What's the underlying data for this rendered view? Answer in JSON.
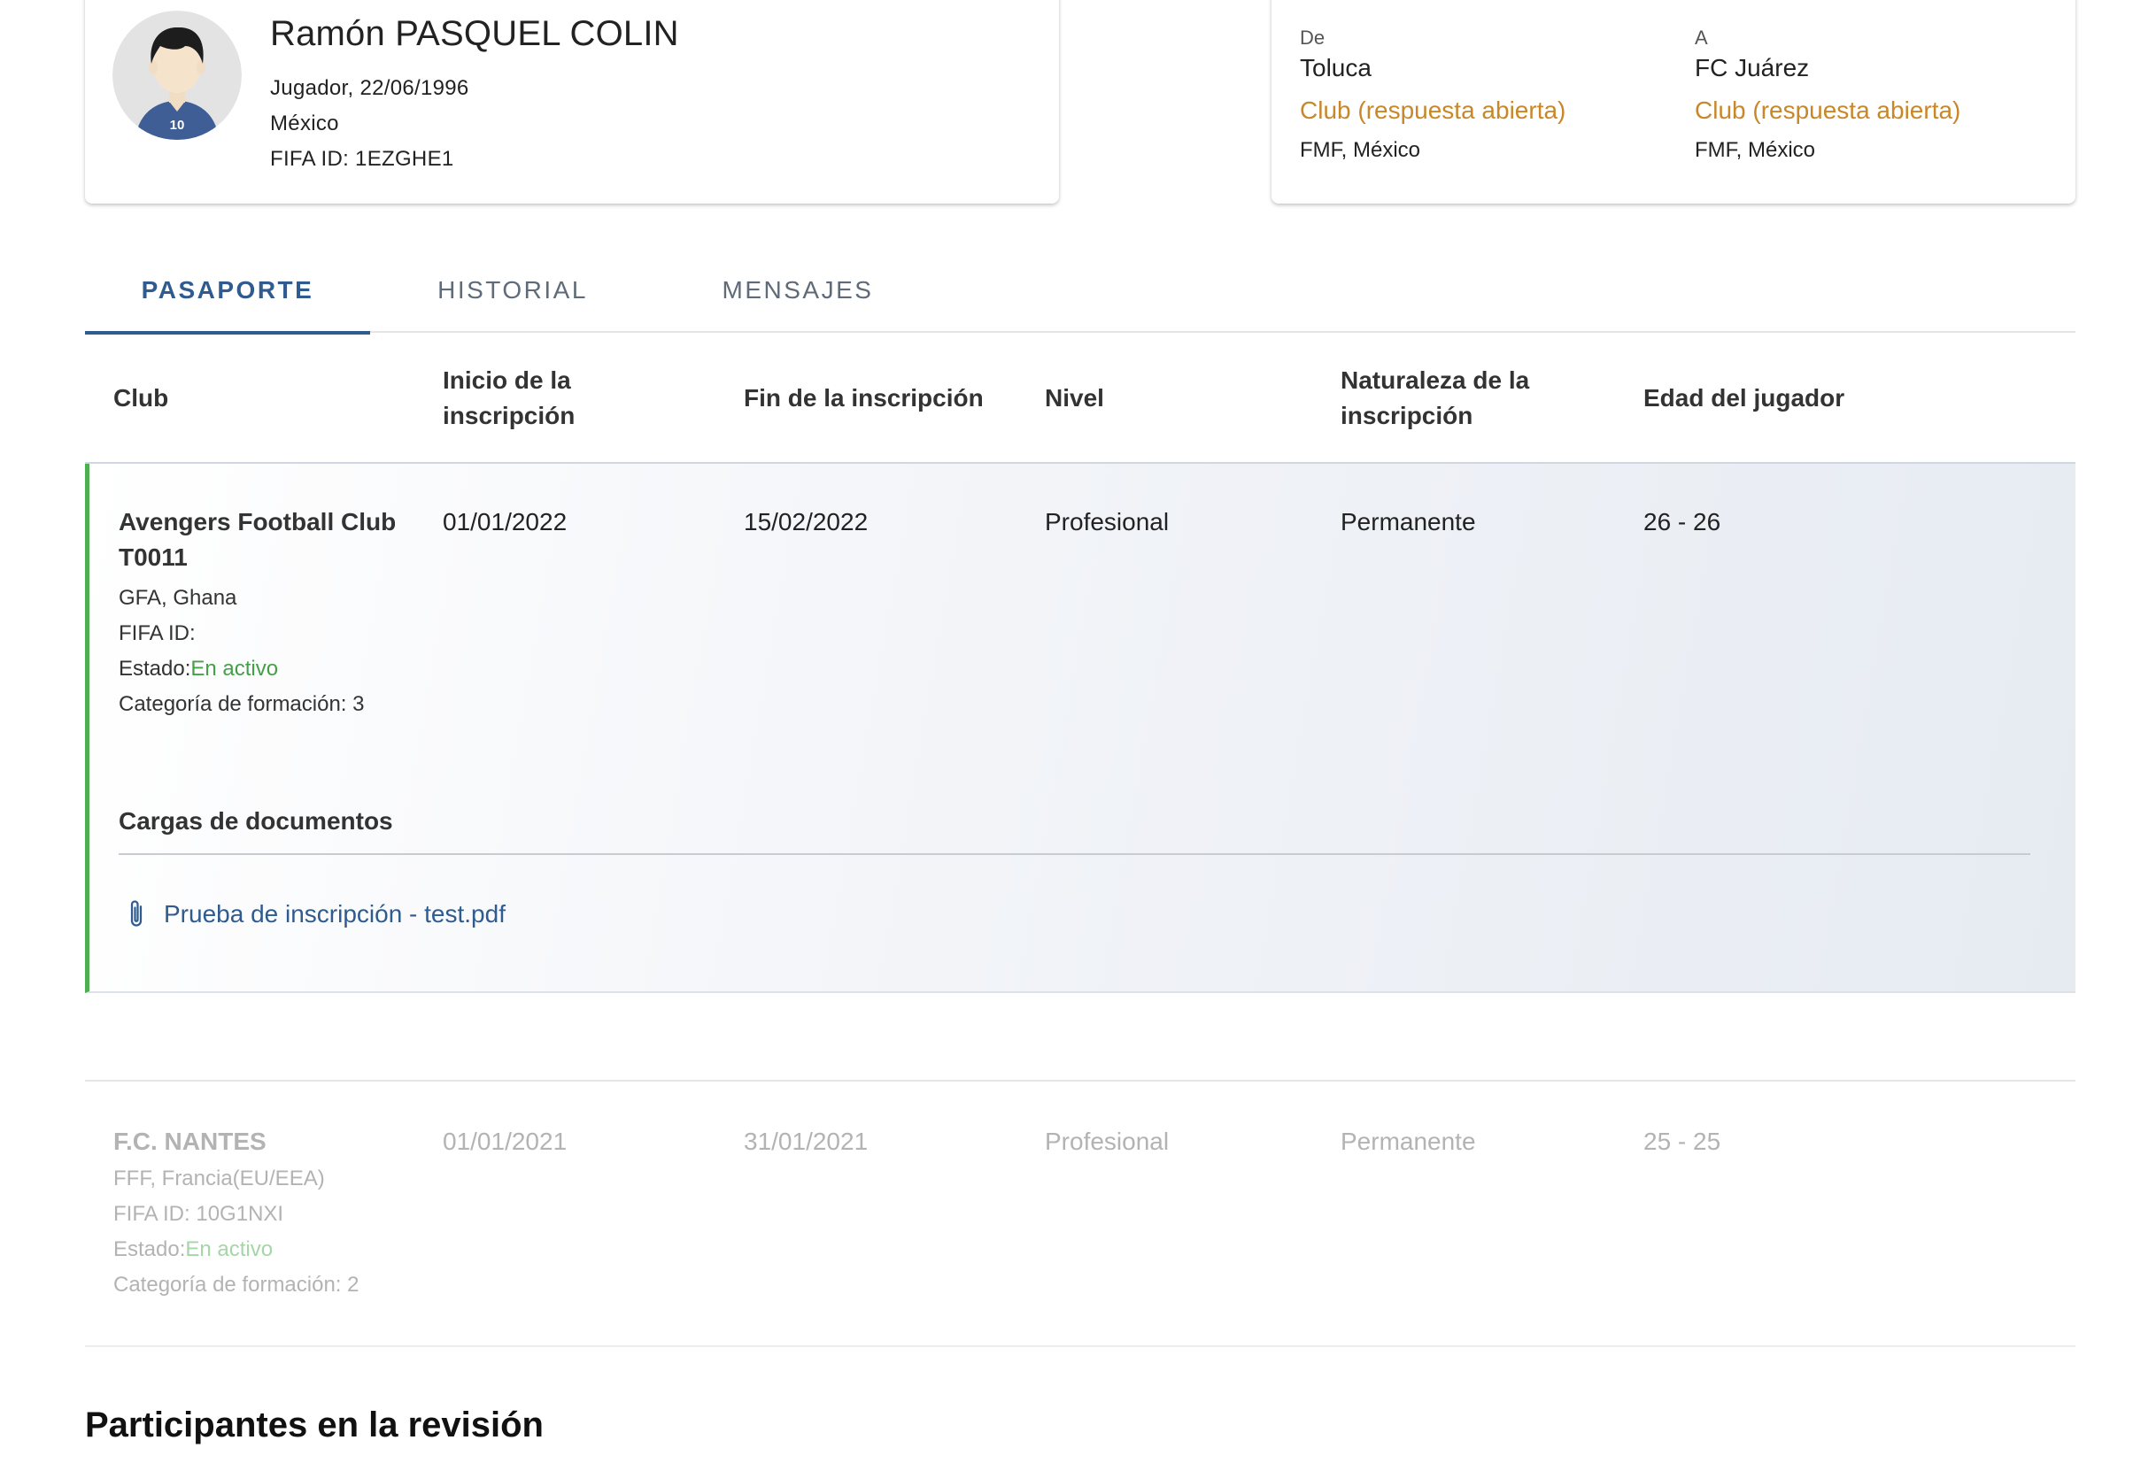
{
  "player": {
    "name": "Ramón PASQUEL COLIN",
    "role_dob": "Jugador, 22/06/1996",
    "country": "México",
    "fifa_id": "FIFA ID: 1EZGHE1",
    "jersey_number": "10"
  },
  "transfer": {
    "from": {
      "label": "De",
      "club": "Toluca",
      "status": "Club (respuesta abierta)",
      "association": "FMF, México"
    },
    "to": {
      "label": "A",
      "club": "FC Juárez",
      "status": "Club (respuesta abierta)",
      "association": "FMF, México"
    }
  },
  "tabs": [
    {
      "label": "PASAPORTE",
      "active": true
    },
    {
      "label": "HISTORIAL",
      "active": false
    },
    {
      "label": "MENSAJES",
      "active": false
    }
  ],
  "table": {
    "headers": [
      "Club",
      "Inicio de la inscripción",
      "Fin de la inscripción",
      "Nivel",
      "Naturaleza de la inscripción",
      "Edad del jugador"
    ],
    "rows": [
      {
        "club": "Avengers Football Club T0011",
        "association": "GFA, Ghana",
        "fifa_id": "FIFA ID:",
        "status_label": "Estado:",
        "status_value": "En activo",
        "category": "Categoría de formación: 3",
        "start": "01/01/2022",
        "end": "15/02/2022",
        "level": "Profesional",
        "nature": "Permanente",
        "age": "26 - 26",
        "documents_title": "Cargas de documentos",
        "documents": [
          "Prueba de inscripción - test.pdf"
        ]
      },
      {
        "club": "F.C. NANTES",
        "association": "FFF, Francia(EU/EEA)",
        "fifa_id": "FIFA ID: 10G1NXI",
        "status_label": "Estado:",
        "status_value": "En activo",
        "category": "Categoría de formación: 2",
        "start": "01/01/2021",
        "end": "31/01/2021",
        "level": "Profesional",
        "nature": "Permanente",
        "age": "25 - 25"
      }
    ]
  },
  "review_section_title": "Participantes en la revisión",
  "colors": {
    "accent": "#2f5b8f",
    "pending_status": "#c8882a",
    "active_status": "#43a047",
    "active_row_border": "#4caf50"
  }
}
